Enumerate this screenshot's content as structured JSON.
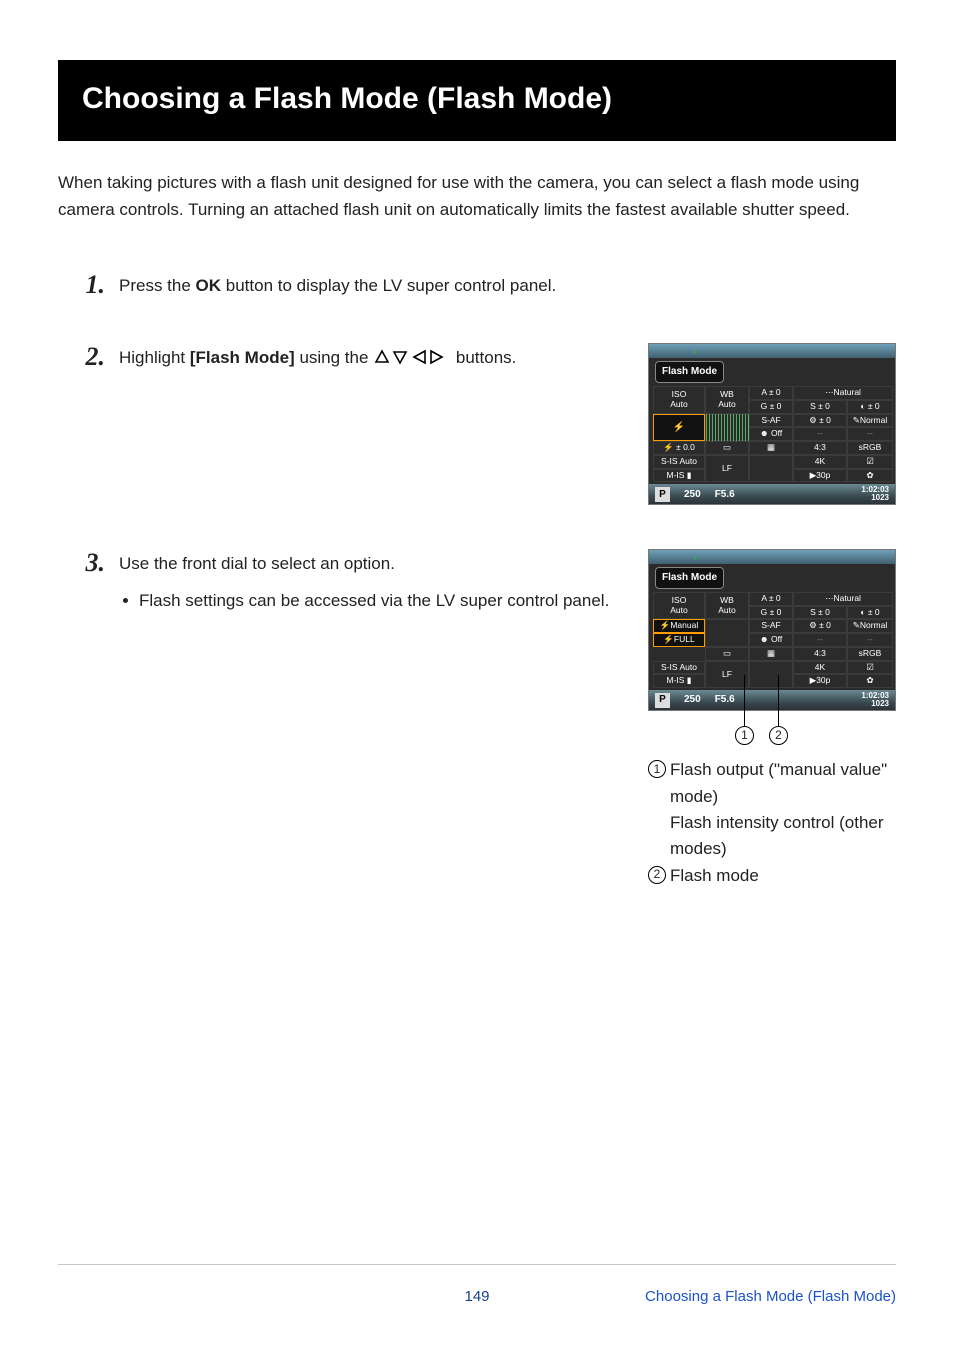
{
  "title": "Choosing a Flash Mode (Flash Mode)",
  "intro": "When taking pictures with a flash unit designed for use with the camera, you can select a flash mode using camera controls. Turning an attached flash unit on automatically limits the fastest available shutter speed.",
  "steps": {
    "s1": {
      "num": "1",
      "text_a": "Press the ",
      "bold_a": "OK",
      "text_b": " button to display the LV super control panel."
    },
    "s2": {
      "num": "2",
      "text_a": "Highlight ",
      "bold_a": "[Flash Mode]",
      "text_b": " using the ",
      "text_c": " buttons."
    },
    "s3": {
      "num": "3",
      "text_a": "Use the front dial to select an option.",
      "bullet": "Flash settings can be accessed via the LV super control panel."
    }
  },
  "cam1": {
    "header": "Flash Mode",
    "cells": {
      "iso": "ISO\nAuto",
      "wb": "WB\nAuto",
      "a0": "A ± 0",
      "nat": "⋯Natural",
      "g0": "G ± 0",
      "s0": "S ± 0",
      "d0": "◐ ± 0",
      "flash_sel": "⚡",
      "saf": "S-AF",
      "p0": "⚙ ± 0",
      "norm": "✎Normal",
      "off": "☻ Off",
      "dash1": "--",
      "dash2": "--",
      "flash_val": "⚡ ± 0.0",
      "rect": "▭",
      "grid": "▦",
      "ar": "4:3",
      "srgb": "sRGB",
      "sis": "S-IS Auto",
      "lf": "LF",
      "k4": "4K",
      "chk": "☑",
      "mis": "M-IS ▮",
      "p30": "▶30p",
      "gear": "✿"
    },
    "bottom": {
      "mode": "P",
      "shutter": "250",
      "ap": "F5.6",
      "time": "1:02:03",
      "count": "1023"
    }
  },
  "cam2": {
    "header": "Flash Mode",
    "cells": {
      "iso": "ISO\nAuto",
      "wb": "WB\nAuto",
      "a0": "A ± 0",
      "nat": "⋯Natural",
      "g0": "G ± 0",
      "s0": "S ± 0",
      "d0": "◐ ± 0",
      "manual": "⚡Manual",
      "saf": "S-AF",
      "p0": "⚙ ± 0",
      "norm": "✎Normal",
      "off": "☻ Off",
      "dash1": "--",
      "dash2": "--",
      "full": "⚡FULL",
      "rect": "▭",
      "grid": "▦",
      "ar": "4:3",
      "srgb": "sRGB",
      "sis": "S-IS Auto",
      "lf": "LF",
      "k4": "4K",
      "chk": "☑",
      "mis": "M-IS ▮",
      "p30": "▶30p",
      "gear": "✿"
    },
    "bottom": {
      "mode": "P",
      "shutter": "250",
      "ap": "F5.6",
      "time": "1:02:03",
      "count": "1023"
    }
  },
  "legend": {
    "l1": "Flash output (\"manual value\" mode)\nFlash intensity control (other modes)",
    "l2": "Flash mode"
  },
  "footer": {
    "page": "149",
    "link": "Choosing a Flash Mode (Flash Mode)"
  }
}
